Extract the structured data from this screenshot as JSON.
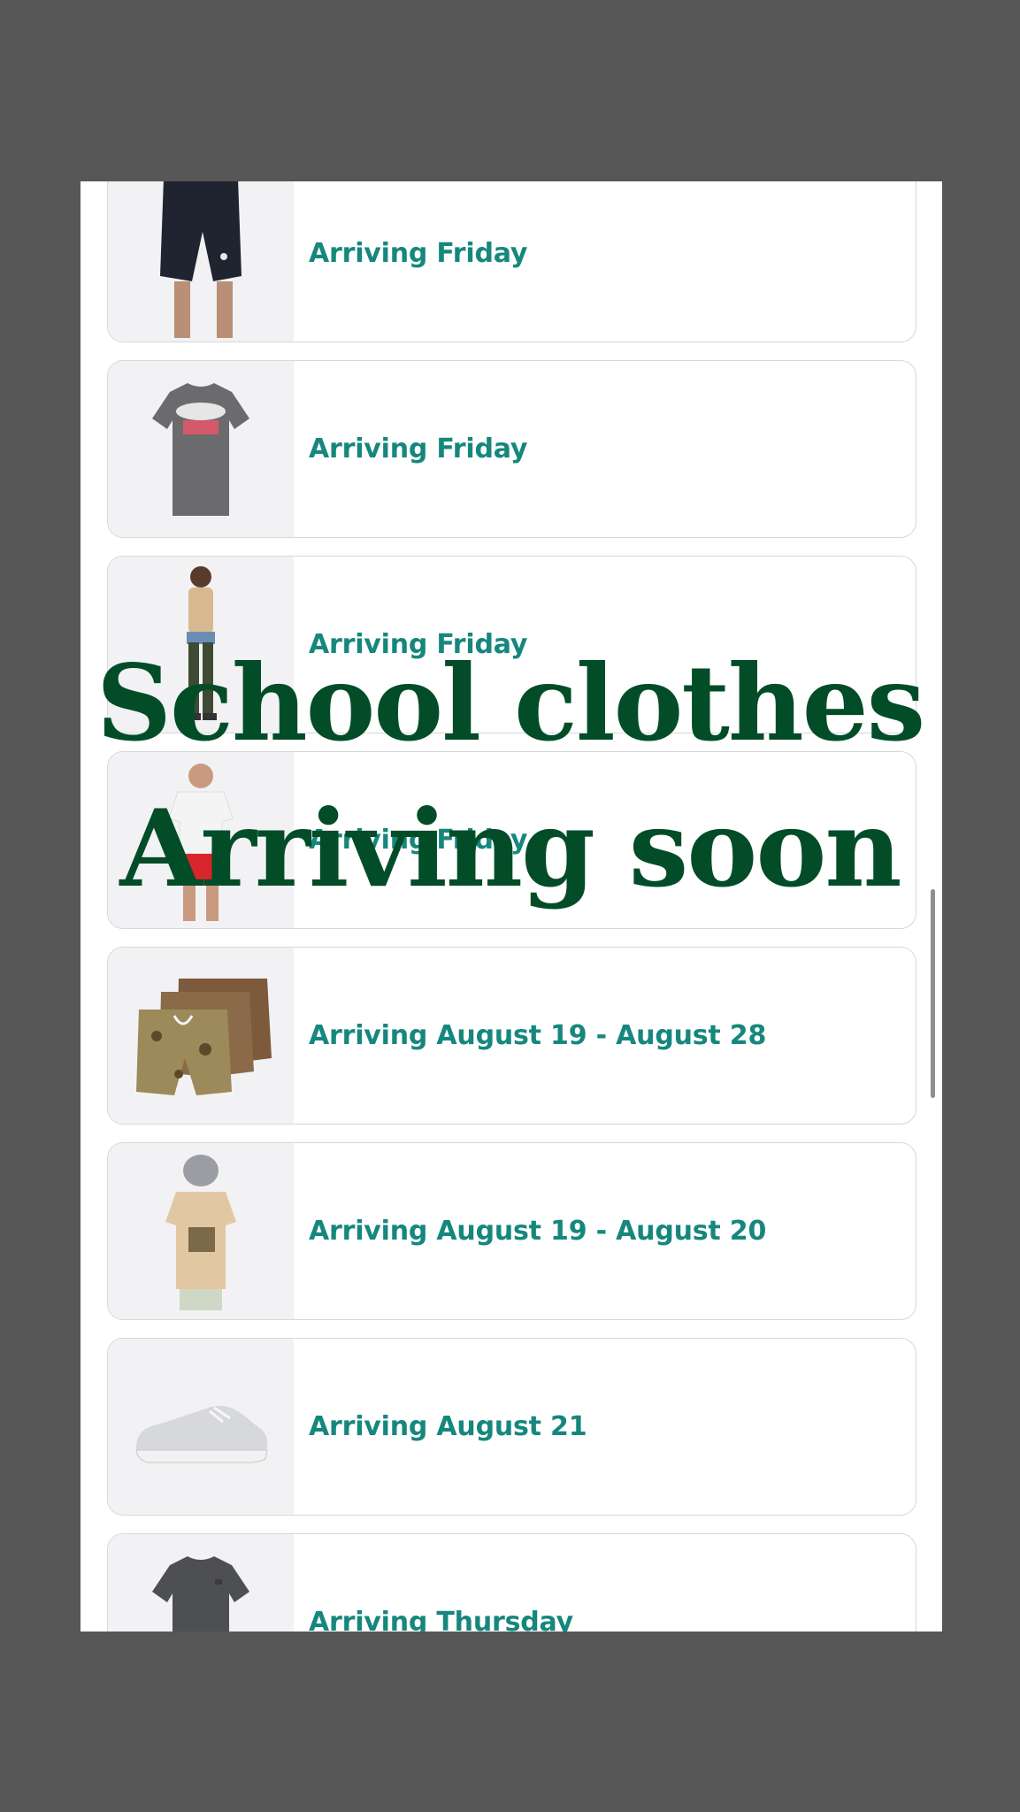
{
  "overlay": {
    "line1": "School clothes",
    "line2": "Arriving soon"
  },
  "orders": [
    {
      "status": "Arriving Friday",
      "image": "black-athletic-shorts"
    },
    {
      "status": "Arriving Friday",
      "image": "gray-tshirt-hook-logo"
    },
    {
      "status": "Arriving Friday",
      "image": "boy-tan-shirt-green-pants"
    },
    {
      "status": "Arriving Friday",
      "image": "man-white-tee-red-shorts"
    },
    {
      "status": "Arriving August 19 - August 28",
      "image": "camo-swim-shorts-pair"
    },
    {
      "status": "Arriving August 19 - August 20",
      "image": "kid-tan-graphic-tee-cap"
    },
    {
      "status": "Arriving August 21",
      "image": "gray-slip-on-shoe"
    },
    {
      "status": "Arriving Thursday",
      "image": "dark-gray-tshirt"
    }
  ],
  "colors": {
    "status_text": "#16877d",
    "overlay_text": "#024d28",
    "backdrop": "#575757"
  }
}
